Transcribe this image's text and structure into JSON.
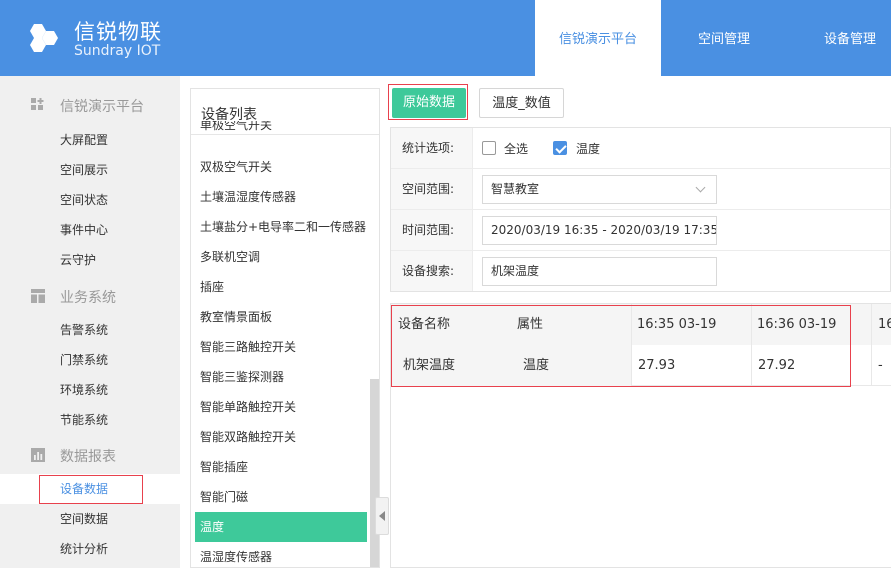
{
  "header": {
    "brand_cn": "信锐物联",
    "brand_en": "Sundray IOT",
    "tabs": [
      {
        "label": "信锐演示平台",
        "active": true
      },
      {
        "label": "空间管理",
        "active": false
      },
      {
        "label": "设备管理",
        "active": false
      }
    ],
    "colors": {
      "header_bg": "#4a90e2",
      "accent_green": "#3ec99a",
      "highlight_red": "#e8414d"
    }
  },
  "sidebar": {
    "groups": [
      {
        "label": "信锐演示平台",
        "icon": "dashboard-icon",
        "items": [
          "大屏配置",
          "空间展示",
          "空间状态",
          "事件中心",
          "云守护"
        ]
      },
      {
        "label": "业务系统",
        "icon": "layout-icon",
        "items": [
          "告警系统",
          "门禁系统",
          "环境系统",
          "节能系统"
        ]
      },
      {
        "label": "数据报表",
        "icon": "bar-chart-icon",
        "items": [
          "设备数据",
          "空间数据",
          "统计分析"
        ]
      }
    ],
    "active_item": "设备数据"
  },
  "device_list": {
    "title": "设备列表",
    "items": [
      "单极空气开关",
      "双极空气开关",
      "土壤温湿度传感器",
      "土壤盐分+电导率二和一传感器",
      "多联机空调",
      "插座",
      "教室情景面板",
      "智能三路触控开关",
      "智能三鉴探测器",
      "智能单路触控开关",
      "智能双路触控开关",
      "智能插座",
      "智能门磁",
      "温度",
      "温湿度传感器"
    ],
    "active_item": "温度"
  },
  "toolbar": {
    "raw_label": "原始数据",
    "value_label": "温度_数值"
  },
  "filters": {
    "stats_label": "统计选项:",
    "select_all_label": "全选",
    "select_all_checked": false,
    "temp_label": "温度",
    "temp_checked": true,
    "space_label": "空间范围:",
    "space_value": "智慧教室",
    "time_label": "时间范围:",
    "time_value": "2020/03/19 16:35 - 2020/03/19 17:35",
    "search_label": "设备搜索:",
    "search_value": "机架温度"
  },
  "table": {
    "columns": [
      "设备名称",
      "属性",
      "16:35 03-19",
      "16:36 03-19",
      "16"
    ],
    "rows": [
      [
        "机架温度",
        "温度",
        "27.93",
        "27.92",
        "-"
      ]
    ]
  }
}
